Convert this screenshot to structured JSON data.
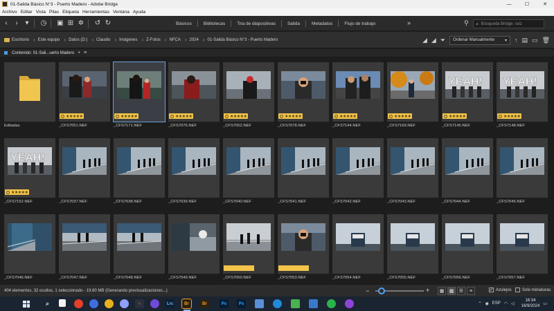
{
  "window": {
    "title": "01-Salida Básico N°3 - Puerto Madero - Adobe Bridge",
    "controls": [
      "—",
      "☐",
      "✕"
    ]
  },
  "menu": [
    "Archivo",
    "Editar",
    "Vista",
    "Pilas",
    "Etiqueta",
    "Herramientas",
    "Ventana",
    "Ayuda"
  ],
  "toolbar": {
    "workspaces": [
      "Básicos",
      "Bibliotecas",
      "Tira de diapositivas",
      "Salida",
      "Metadatos",
      "Flujo de trabajo"
    ],
    "more": "»",
    "search_placeholder": "Búsqueda Bridge: raíz"
  },
  "path": {
    "crumbs": [
      "Escritorio",
      "Este equipo",
      "Datos (D:)",
      "Claudio",
      "Imágenes",
      "Z-Fotos",
      "NFCA",
      "2024",
      "01-Salida Básico N°3 - Puerto Madero"
    ],
    "sort_label": "Ordenar Manualmente"
  },
  "content": {
    "header": "Contenido: 01-Sali...uerto Madero",
    "plus": "+",
    "menu": "≡"
  },
  "items": [
    {
      "name": "Editadas",
      "type": "folder"
    },
    {
      "name": "_CFS7051.NEF",
      "rating": 5,
      "scene": "a"
    },
    {
      "name": "_CFS7171.NEF",
      "rating": 5,
      "scene": "b",
      "selected": true
    },
    {
      "name": "_CFS7076.NEF",
      "rating": 5,
      "scene": "c"
    },
    {
      "name": "_CFS7052.NEF",
      "rating": 5,
      "scene": "d"
    },
    {
      "name": "_CFS7078.NEF",
      "rating": 5,
      "scene": "e"
    },
    {
      "name": "_CFS7144.NEF",
      "rating": 5,
      "scene": "f"
    },
    {
      "name": "_CFS7169.NEF",
      "rating": 5,
      "scene": "g"
    },
    {
      "name": "_CFS7145.NEF",
      "rating": 5,
      "scene": "h"
    },
    {
      "name": "_CFS7148.NEF",
      "rating": 5,
      "scene": "h"
    },
    {
      "name": "_CFS7152.NEF",
      "rating": 5,
      "scene": "h"
    },
    {
      "name": "_CFS7037.NEF",
      "scene": "i"
    },
    {
      "name": "_CFS7038.NEF",
      "scene": "i"
    },
    {
      "name": "_CFS7039.NEF",
      "scene": "i"
    },
    {
      "name": "_CFS7040.NEF",
      "scene": "i"
    },
    {
      "name": "_CFS7041.NEF",
      "scene": "i"
    },
    {
      "name": "_CFS7042.NEF",
      "scene": "i"
    },
    {
      "name": "_CFS7043.NEF",
      "scene": "i"
    },
    {
      "name": "_CFS7044.NEF",
      "scene": "i"
    },
    {
      "name": "_CFS7045.NEF",
      "scene": "i"
    },
    {
      "name": "_CFS7046.NEF",
      "scene": "j"
    },
    {
      "name": "_CFS7047.NEF",
      "scene": "k"
    },
    {
      "name": "_CFS7048.NEF",
      "scene": "k"
    },
    {
      "name": "_CFS7049.NEF",
      "scene": "l"
    },
    {
      "name": "_CFS7050.NEF",
      "scene": "m",
      "label": true
    },
    {
      "name": "_CFS7053.NEF",
      "scene": "e",
      "label": true
    },
    {
      "name": "_CFS7054.NEF",
      "scene": "n"
    },
    {
      "name": "_CFS7055.NEF",
      "scene": "n"
    },
    {
      "name": "_CFS7056.NEF",
      "scene": "n"
    },
    {
      "name": "_CFS7057.NEF",
      "scene": "n"
    }
  ],
  "status": {
    "text": "404 elementos, 32 ocultos, 1 seleccionado - 19.60 MB (Generando previsualizaciones...)",
    "zoom_minus": "−",
    "zoom_plus": "+",
    "zoom_level": 0.05,
    "checkbox_azulejos": "Azulejos",
    "checkbox_miniaturas": "Solo miniaturas"
  },
  "taskbar": {
    "lang": "ESP",
    "time": "16:34",
    "date": "16/9/2024",
    "apps": [
      "Lrc",
      "Br",
      "Br",
      "Ps",
      "Ps"
    ]
  }
}
